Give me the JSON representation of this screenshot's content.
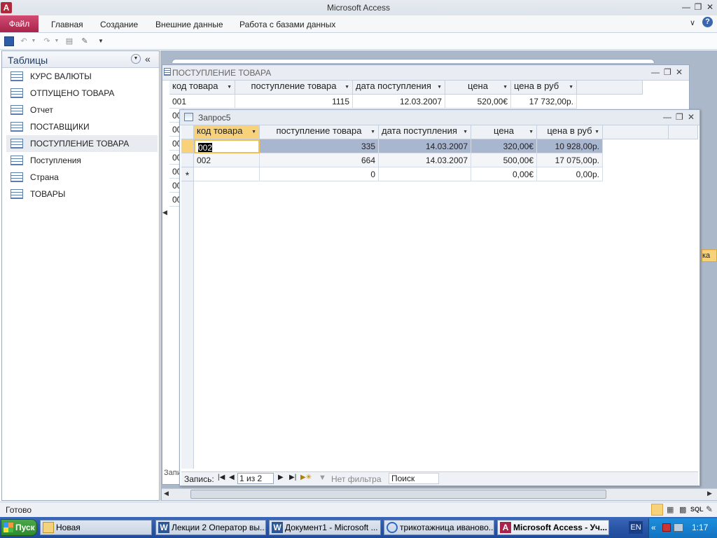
{
  "window": {
    "title": "Microsoft Access"
  },
  "ribbon": {
    "file": "Файл",
    "tabs": [
      "Главная",
      "Создание",
      "Внешние данные",
      "Работа с базами данных"
    ]
  },
  "nav": {
    "title": "Таблицы",
    "items": [
      "КУРС ВАЛЮТЫ",
      "ОТПУЩЕНО ТОВАРА",
      "Отчет",
      "ПОСТАВЩИКИ",
      "ПОСТУПЛЕНИЕ ТОВАРА",
      "Поступления",
      "Страна",
      "ТОВАРЫ"
    ],
    "selected_index": 4
  },
  "back_window": {
    "title": "ПОСТУПЛЕНИЕ ТОВАРА",
    "columns": [
      "код товара",
      "поступление товара",
      "дата поступления",
      "цена",
      "цена в руб"
    ],
    "row": [
      "001",
      "1115",
      "12.03.2007",
      "520,00€",
      "17 732,00р."
    ],
    "partial_rows": [
      "00",
      "00",
      "00",
      "00",
      "00",
      "00",
      "00"
    ],
    "record_label_partial": "Запи",
    "side_partial": "ка"
  },
  "query_window": {
    "title": "Запрос5",
    "columns": [
      "код товара",
      "поступление товара",
      "дата поступления",
      "цена",
      "цена в руб"
    ],
    "rows": [
      [
        "002",
        "335",
        "14.03.2007",
        "320,00€",
        "10 928,00р."
      ],
      [
        "002",
        "664",
        "14.03.2007",
        "500,00€",
        "17 075,00р."
      ]
    ],
    "new_row": [
      "",
      "0",
      "",
      "0,00€",
      "0,00р."
    ],
    "new_row_marker": "*",
    "record_nav": {
      "label": "Запись:",
      "value": "1 из 2",
      "filter": "Нет фильтра",
      "search": "Поиск"
    }
  },
  "status": {
    "text": "Готово",
    "view_label": "SQL"
  },
  "taskbar": {
    "start": "Пуск",
    "buttons": [
      "Новая",
      "Лекции 2 Оператор вы...",
      "Документ1 - Microsoft ...",
      "трикотажница иваново...",
      "Microsoft Access - Уч..."
    ],
    "lang": "EN",
    "clock": "1:17"
  },
  "colors": {
    "accent": "#a7244a",
    "selected_row": "#a9b6cf",
    "header_active": "#f7d27a",
    "taskbar": "#2a56a8"
  }
}
